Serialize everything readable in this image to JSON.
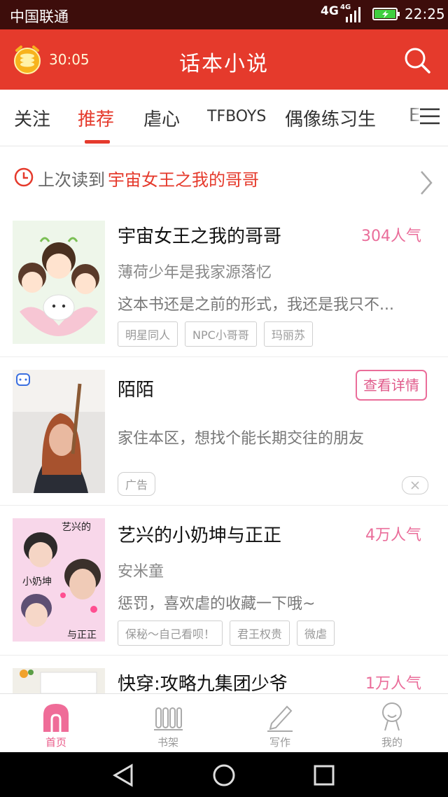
{
  "status_bar": {
    "carrier": "中国联通",
    "network": "4G",
    "network_small": "4G",
    "time": "22:25"
  },
  "header": {
    "timer": "30:05",
    "title": "话本小说",
    "coin_icon": "alarm-coin-icon",
    "search_icon": "search-icon"
  },
  "tabs": [
    {
      "label": "关注"
    },
    {
      "label": "推荐",
      "active": true
    },
    {
      "label": "虐心"
    },
    {
      "label": "TFBOYS"
    },
    {
      "label": "偶像练习生"
    },
    {
      "label": "E"
    }
  ],
  "last_read": {
    "label": "上次读到",
    "book": "宇宙女王之我的哥哥"
  },
  "items": [
    {
      "name": "宇宙女王之我的哥哥",
      "popularity": "304人气",
      "author": "薄荷少年是我家源落忆",
      "desc": "这本书还是之前的形式，我还是我只不...",
      "tags": [
        "明星同人",
        "NPC小哥哥",
        "玛丽苏"
      ]
    },
    {
      "name": "陌陌",
      "button": "查看详情",
      "desc": "家住本区，想找个能长期交往的朋友",
      "ad_label": "广告"
    },
    {
      "name": "艺兴的小奶坤与正正",
      "popularity": "4万人气",
      "author": "安米童",
      "desc": "惩罚，喜欢虐的收藏一下哦~",
      "tags": [
        "保秘～自己看呗！",
        "君王权贵",
        "微虐"
      ],
      "cover_text": [
        "艺兴的",
        "小奶坤",
        "与正正"
      ]
    },
    {
      "name": "快穿:攻略九集团少爷",
      "popularity": "1万人气"
    }
  ],
  "bottom_nav": [
    {
      "label": "首页",
      "icon": "home-icon",
      "active": true
    },
    {
      "label": "书架",
      "icon": "bookshelf-icon"
    },
    {
      "label": "写作",
      "icon": "pen-icon"
    },
    {
      "label": "我的",
      "icon": "profile-icon"
    }
  ],
  "colors": {
    "accent": "#e53a2c",
    "pink": "#ea6d9a",
    "status_bar": "#3d0d0b"
  }
}
